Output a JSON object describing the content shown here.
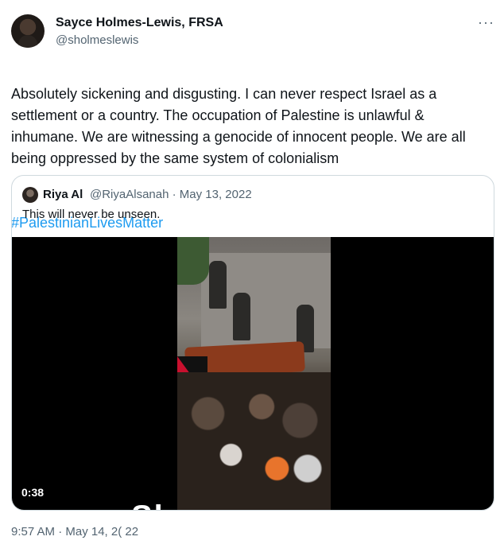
{
  "tweet": {
    "author_name": "Sayce Holmes-Lewis, FRSA",
    "author_handle": "@sholmeslewis",
    "more_label": "···",
    "text": "Absolutely sickening and disgusting. I can never respect Israel as a settlement or a country. The occupation of Palestine is unlawful & inhumane. We are witnessing a genocide of innocent people. We are all being oppressed by the same system of colonialism",
    "hashtag": "#PalestinianLivesMatter",
    "timestamp": "9:57 AM · May 14, 2( 22"
  },
  "quote": {
    "author_name": "Riya Al",
    "meta": "@RiyaAlsanah · May 13, 2022",
    "text": "This will never be unseen.",
    "video": {
      "duration": "0:38",
      "overlay_text": "Sh..."
    }
  },
  "icons": {
    "avatar": "avatar",
    "more": "more-icon",
    "quote_avatar": "avatar"
  }
}
